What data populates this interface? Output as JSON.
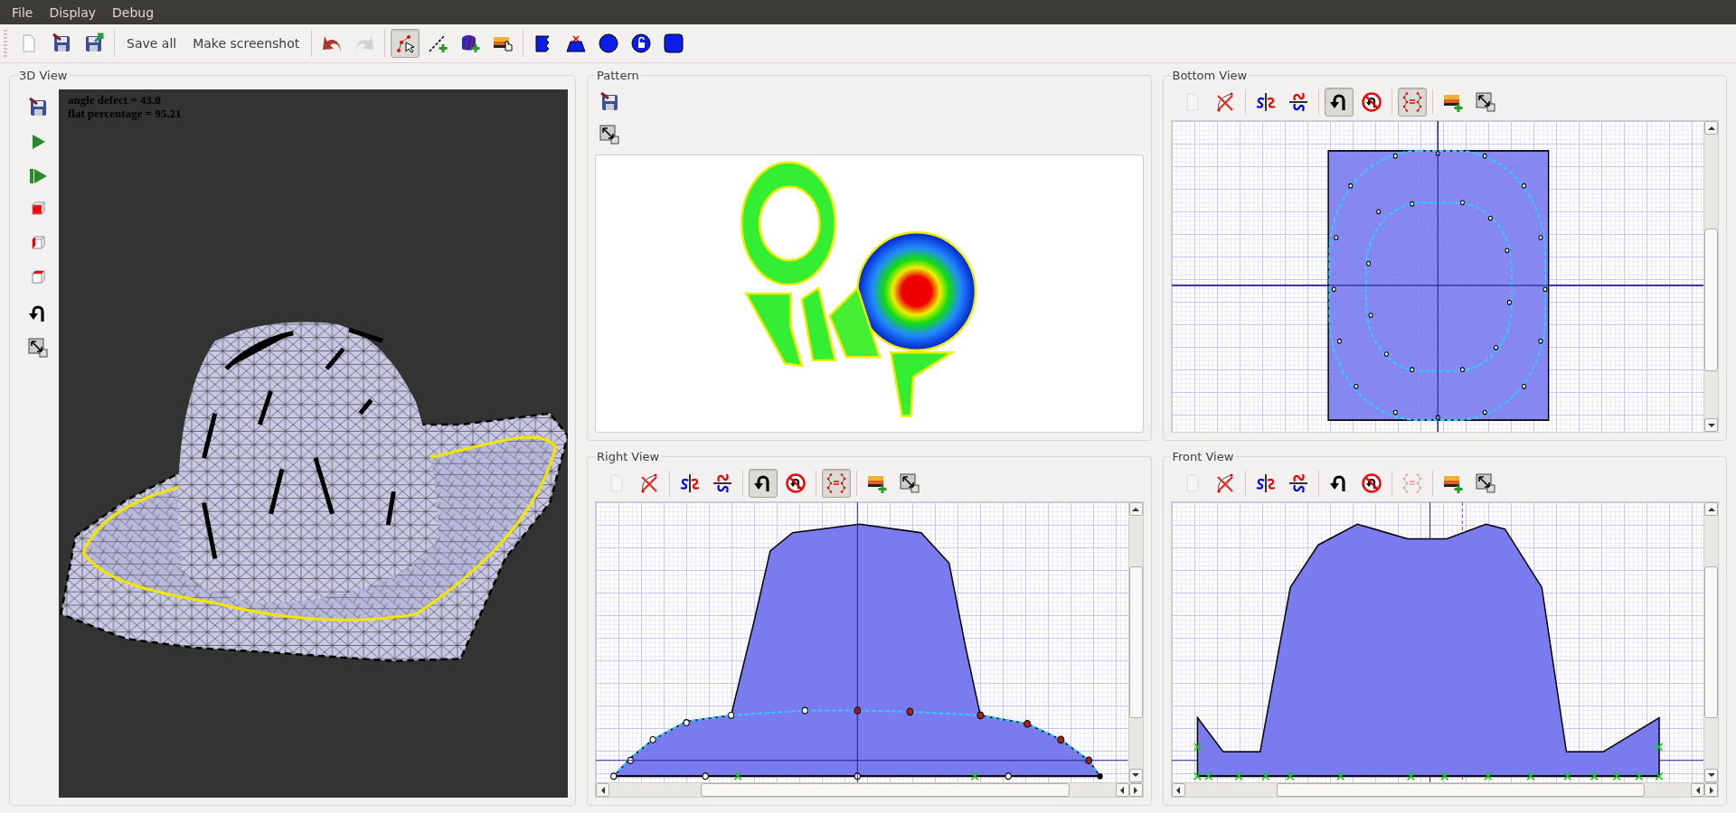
{
  "menu": [
    {
      "label": "File"
    },
    {
      "label": "Display"
    },
    {
      "label": "Debug"
    }
  ],
  "toolbar": [
    {
      "kind": "icon",
      "disabled": false
    },
    {
      "kind": "icon",
      "disabled": false
    },
    {
      "kind": "icon",
      "disabled": false
    },
    {
      "kind": "separator"
    },
    {
      "kind": "text",
      "label": "Save all"
    },
    {
      "kind": "text",
      "label": "Make screenshot"
    },
    {
      "kind": "separator"
    },
    {
      "kind": "icon",
      "disabled": false
    },
    {
      "kind": "icon",
      "disabled": true
    },
    {
      "kind": "separator"
    },
    {
      "kind": "icon",
      "checked": true,
      "disabled": false
    },
    {
      "kind": "icon",
      "disabled": false
    },
    {
      "kind": "icon",
      "disabled": false
    },
    {
      "kind": "icon",
      "disabled": false
    },
    {
      "kind": "separator"
    },
    {
      "kind": "icon",
      "disabled": false
    },
    {
      "kind": "icon",
      "disabled": false
    },
    {
      "kind": "icon",
      "disabled": false
    },
    {
      "kind": "icon",
      "disabled": false
    },
    {
      "kind": "icon",
      "disabled": false
    }
  ],
  "view_3d": {
    "title": "3D View",
    "stats": [
      "angle defect = 43.8",
      "flat percentage = 95.21"
    ]
  },
  "pattern": {
    "title": "Pattern"
  },
  "views": [
    {
      "title": "Bottom View",
      "kind": "bottom",
      "tools": [
        {
          "disabled": true
        },
        {
          "disabled": false
        },
        {
          "disabled": false
        },
        {
          "disabled": false
        },
        {
          "checked": true,
          "disabled": false
        },
        {
          "disabled": false
        },
        {
          "checked": true,
          "disabled": false
        },
        {
          "disabled": false
        },
        {
          "disabled": false
        }
      ]
    },
    {
      "title": "Right View",
      "kind": "right",
      "tools": [
        {
          "disabled": true
        },
        {
          "disabled": false
        },
        {
          "disabled": false
        },
        {
          "disabled": false
        },
        {
          "checked": true,
          "disabled": false
        },
        {
          "disabled": false
        },
        {
          "checked": true,
          "disabled": false
        },
        {
          "disabled": false
        },
        {
          "disabled": false
        }
      ]
    },
    {
      "title": "Front View",
      "kind": "front",
      "tools": [
        {
          "disabled": true
        },
        {
          "disabled": false
        },
        {
          "disabled": false
        },
        {
          "disabled": false
        },
        {
          "disabled": false
        },
        {
          "disabled": false
        },
        {
          "disabled": true
        },
        {
          "disabled": false
        },
        {
          "disabled": false
        }
      ]
    }
  ]
}
